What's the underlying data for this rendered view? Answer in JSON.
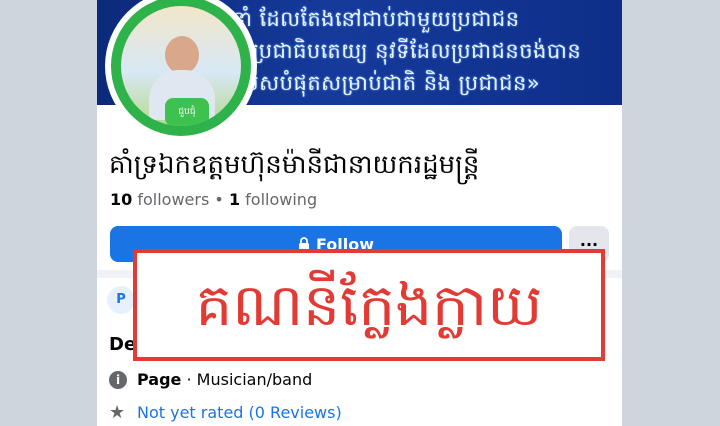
{
  "cover": {
    "lines": [
      "នាំ ដែលតែងនៅជាប់ជាមួយប្រជាជន",
      "ជាប្រជាធិបតេយ្យ នុវទីដែលប្រជាជនចង់បាន",
      "លើសបំផុតសម្រាប់ជាតិ និង ប្រជាជន»"
    ]
  },
  "profile": {
    "badge_text": "ជួបជុំ",
    "name": "គាំទ្រឯកឧត្តមហ៊ុនម៉ានីជានាយករដ្ឋមន្ត្រី",
    "followers_count": "10",
    "followers_label": "followers",
    "separator": "•",
    "following_count": "1",
    "following_label": "following"
  },
  "actions": {
    "follow_label": "Follow",
    "more_label": "···"
  },
  "tabs": {
    "first_tab_letter": "P"
  },
  "details": {
    "section_title": "De",
    "category_strong": "Page",
    "category_rest": "· Musician/band",
    "rating": "Not yet rated (0 Reviews)"
  },
  "overlay": {
    "text": "គណនីក្លែងក្លាយ",
    "color": "#e23b36"
  },
  "colors": {
    "accent": "#1b74e4",
    "cover": "#163a9b"
  },
  "icons": [
    "lock-icon",
    "info-icon",
    "star-icon",
    "more-icon"
  ]
}
